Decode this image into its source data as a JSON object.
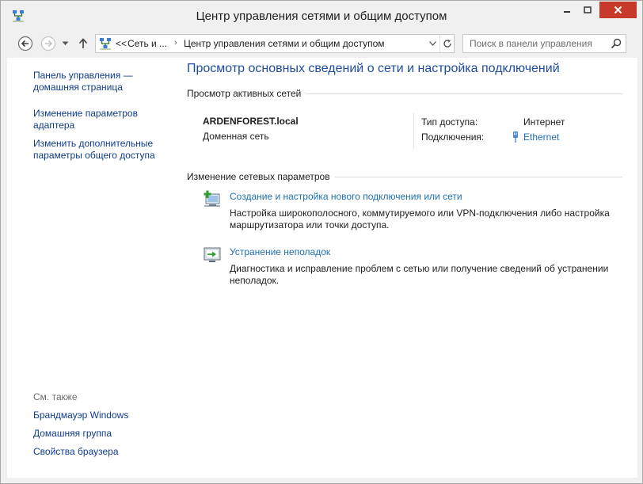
{
  "window": {
    "title": "Центр управления сетями и общим доступом"
  },
  "address_bar": {
    "overflow": "<<",
    "crumb_1": "Сеть и ...",
    "crumb_2": "Центр управления сетями и общим доступом"
  },
  "search": {
    "placeholder": "Поиск в панели управления"
  },
  "sidebar": {
    "home_link": "Панель управления —\nдомашняя страница",
    "adapter_link": "Изменение параметров\nадаптера",
    "sharing_link": "Изменить дополнительные\nпараметры общего доступа",
    "see_also": "См. также",
    "see_also_items": [
      "Брандмауэр Windows",
      "Домашняя группа",
      "Свойства браузера"
    ]
  },
  "main": {
    "title": "Просмотр основных сведений о сети и настройка подключений",
    "active_networks_header": "Просмотр активных сетей",
    "network": {
      "name": "ARDENFOREST.local",
      "category": "Доменная сеть",
      "access_label": "Тип доступа:",
      "access_value": "Интернет",
      "connections_label": "Подключения:",
      "connection_name": "Ethernet"
    },
    "change_settings_header": "Изменение сетевых параметров",
    "tasks": [
      {
        "title": "Создание и настройка нового подключения или сети",
        "description": "Настройка широкополосного, коммутируемого или VPN-подключения либо настройка маршрутизатора или точки доступа."
      },
      {
        "title": "Устранение неполадок",
        "description": "Диагностика и исправление проблем с сетью или получение сведений об устранении неполадок."
      }
    ]
  },
  "colors": {
    "link": "#1e6fb3",
    "sidebar_link": "#0e3c8a",
    "title": "#1e4d9c",
    "close_button": "#c7392b"
  },
  "icons": {
    "app": "network-icon",
    "back": "back-arrow-icon",
    "forward": "forward-arrow-icon",
    "recent": "chevron-down-icon",
    "up": "up-arrow-icon",
    "refresh": "refresh-icon",
    "search": "search-icon",
    "ethernet": "ethernet-plug-icon",
    "new_connection": "new-connection-icon",
    "troubleshoot": "troubleshoot-icon"
  }
}
